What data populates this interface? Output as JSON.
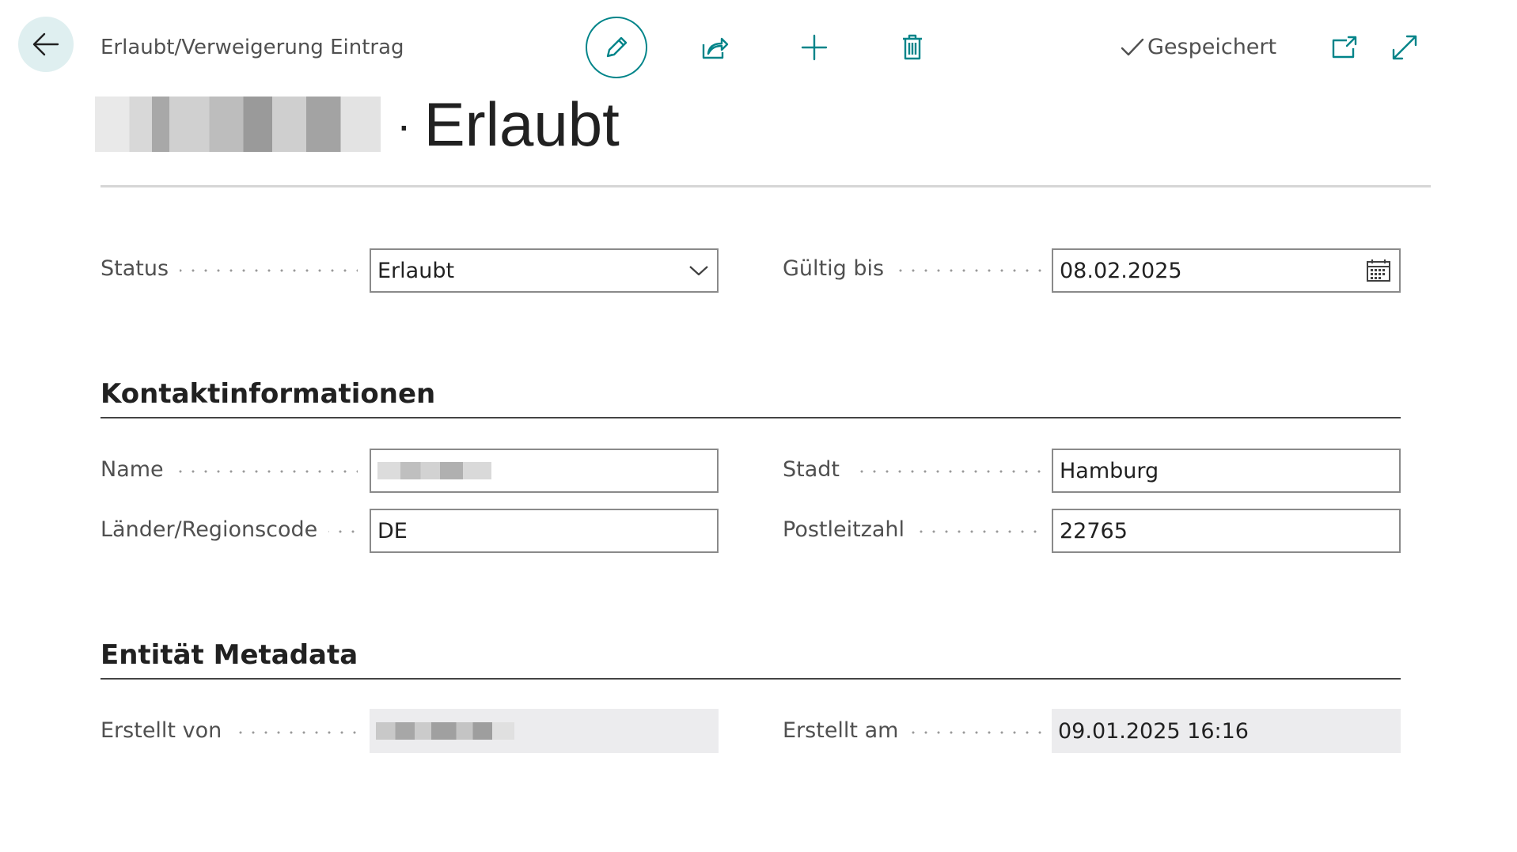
{
  "header": {
    "caption": "Erlaubt/Verweigerung Eintrag",
    "saved_status": "Gespeichert",
    "icons": {
      "back": "arrow-left-icon",
      "edit": "pencil-icon",
      "share": "share-icon",
      "new": "plus-icon",
      "delete": "trash-icon",
      "saved": "checkmark-icon",
      "popout": "open-in-new-window-icon",
      "expand": "expand-icon"
    },
    "accent_color": "#008489"
  },
  "record": {
    "separator": "·",
    "status_title": "Erlaubt"
  },
  "general": {
    "status_label": "Status",
    "status_value": "Erlaubt",
    "valid_until_label": "Gültig bis",
    "valid_until_value": "08.02.2025"
  },
  "contact": {
    "title": "Kontaktinformationen",
    "name_label": "Name",
    "country_label": "Länder/Regionscode",
    "country_value": "DE",
    "city_label": "Stadt",
    "city_value": "Hamburg",
    "postcode_label": "Postleitzahl",
    "postcode_value": "22765"
  },
  "metadata": {
    "title": "Entität Metadata",
    "created_by_label": "Erstellt von",
    "created_at_label": "Erstellt am",
    "created_at_value": "09.01.2025 16:16"
  }
}
